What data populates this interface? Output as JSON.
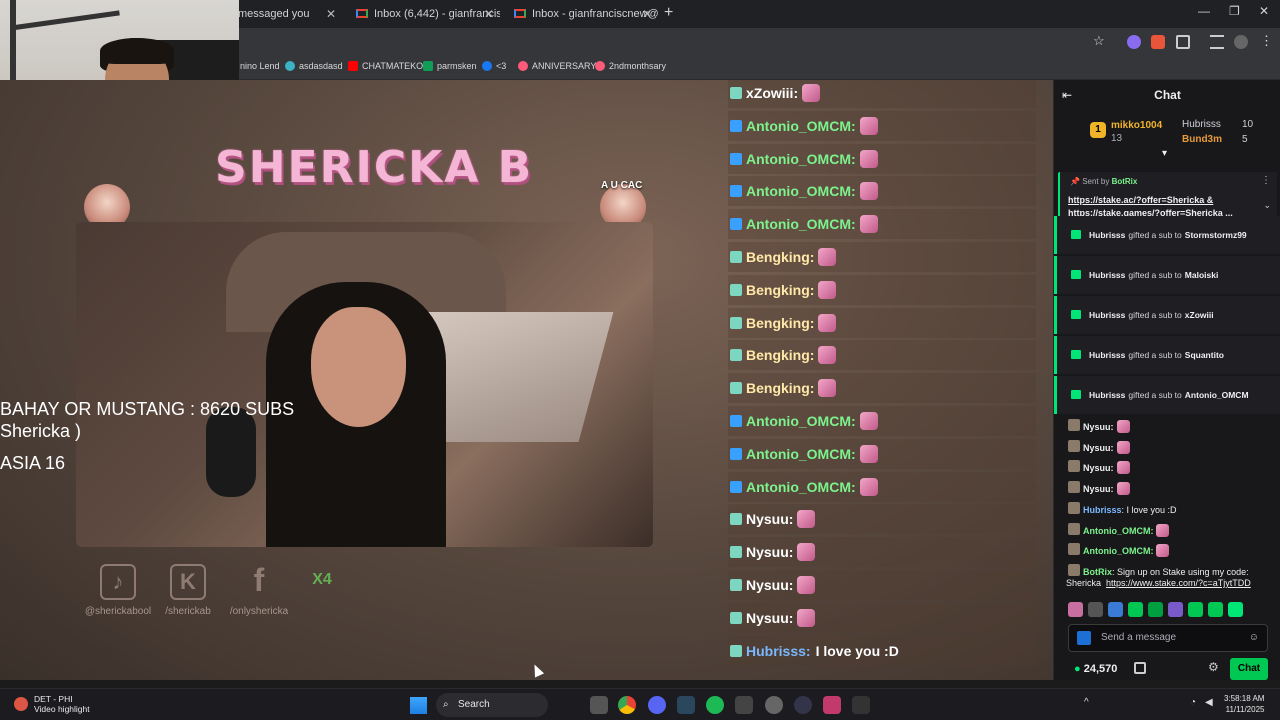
{
  "browser": {
    "tabs": [
      {
        "label": "messaged you"
      },
      {
        "label": "Inbox (6,442) - gianfrancisc@gi"
      },
      {
        "label": "Inbox - gianfranciscnew@gma"
      }
    ],
    "new_tab": "+",
    "bookmarks": [
      {
        "label": "nino Lend"
      },
      {
        "label": "asdasdasd"
      },
      {
        "label": "CHATMATEKO"
      },
      {
        "label": "parmsken"
      },
      {
        "label": "<3"
      },
      {
        "label": "ANNIVERSARY"
      },
      {
        "label": "2ndmonthsary"
      }
    ]
  },
  "stream": {
    "title": "SHERICKA B",
    "avatar_caption": "A U CAC",
    "overlay_lines": [
      "BAHAY OR MUSTANG : 8620 SUBS",
      "Shericka )",
      "",
      "ASIA 16"
    ],
    "socials": [
      {
        "label": "@sherickabool",
        "icon": "tiktok-icon",
        "glyph": "♪"
      },
      {
        "label": "/sherickab",
        "icon": "kick-icon",
        "glyph": "K"
      },
      {
        "label": "/onlyshericka",
        "icon": "facebook-icon",
        "glyph": "f"
      },
      {
        "label": "",
        "icon": "x4-icon",
        "glyph": "X4"
      }
    ]
  },
  "stream_chat": [
    {
      "name": "xZowiii:",
      "color": "#ffffff"
    },
    {
      "name": "Antonio_OMCM:",
      "color": "#7cf28c"
    },
    {
      "name": "Antonio_OMCM:",
      "color": "#7cf28c"
    },
    {
      "name": "Antonio_OMCM:",
      "color": "#7cf28c"
    },
    {
      "name": "Antonio_OMCM:",
      "color": "#7cf28c"
    },
    {
      "name": "Bengking:",
      "color": "#ffe9a8"
    },
    {
      "name": "Bengking:",
      "color": "#ffe9a8"
    },
    {
      "name": "Bengking:",
      "color": "#ffe9a8"
    },
    {
      "name": "Bengking:",
      "color": "#ffe9a8"
    },
    {
      "name": "Bengking:",
      "color": "#ffe9a8"
    },
    {
      "name": "Antonio_OMCM:",
      "color": "#7cf28c"
    },
    {
      "name": "Antonio_OMCM:",
      "color": "#7cf28c"
    },
    {
      "name": "Antonio_OMCM:",
      "color": "#7cf28c"
    },
    {
      "name": "Nysuu:",
      "color": "#ffffff"
    },
    {
      "name": "Nysuu:",
      "color": "#ffffff"
    },
    {
      "name": "Nysuu:",
      "color": "#ffffff"
    },
    {
      "name": "Nysuu:",
      "color": "#ffffff"
    },
    {
      "name": "Hubrisss:",
      "color": "#7ab8ff",
      "text": "I love you :D"
    }
  ],
  "chat": {
    "title": "Chat",
    "leaderboard": [
      {
        "rank": "1",
        "name": "mikko1004",
        "count": "13"
      },
      {
        "name": "Hubrisss",
        "count": "10"
      },
      {
        "name": "Bund3m",
        "count": "5"
      }
    ],
    "pinned": {
      "sent_by_label": "Sent by",
      "sender": "BotRix",
      "text_line1": "https://stake.ac/?offer=Shericka &",
      "text_line2": "https://stake.games/?offer=Shericka ..."
    },
    "gifts": [
      {
        "gifter": "Hubrisss",
        "text": "gifted a sub to",
        "recipient": "Stormstormz99"
      },
      {
        "gifter": "Hubrisss",
        "text": "gifted a sub to",
        "recipient": "Maloiski"
      },
      {
        "gifter": "Hubrisss",
        "text": "gifted a sub to",
        "recipient": "xZowiii"
      },
      {
        "gifter": "Hubrisss",
        "text": "gifted a sub to",
        "recipient": "Squantito"
      },
      {
        "gifter": "Hubrisss",
        "text": "gifted a sub to",
        "recipient": "Antonio_OMCM"
      }
    ],
    "messages": [
      {
        "name": "Nysuu:",
        "color": "#efeff1",
        "text": ""
      },
      {
        "name": "Nysuu:",
        "color": "#efeff1",
        "text": ""
      },
      {
        "name": "Nysuu:",
        "color": "#efeff1",
        "text": ""
      },
      {
        "name": "Nysuu:",
        "color": "#efeff1",
        "text": ""
      },
      {
        "name": "Hubrisss",
        "color": "#7ab8ff",
        "text": ": I love you :D"
      },
      {
        "name": "Antonio_OMCM:",
        "color": "#7cf28c",
        "text": ""
      },
      {
        "name": "Antonio_OMCM:",
        "color": "#7cf28c",
        "text": ""
      },
      {
        "name": "BotRix",
        "color": "#7cf28c",
        "text": ": Sign up on Stake using my code:"
      }
    ],
    "botrix_line2": "Shericka",
    "botrix_link": "https://www.stake.com/?c=aTjytTDD",
    "send_placeholder": "Send a message",
    "points": "24,570",
    "chat_button": "Chat"
  },
  "taskbar": {
    "weather_line1": "DET - PHI",
    "weather_line2": "Video highlight",
    "search_label": "Search",
    "time": "3:58:18 AM",
    "date": "11/11/2025"
  },
  "colors": {
    "accent_green": "#00e676",
    "chat_bg": "#18181b",
    "kick_green": "#00c853"
  }
}
